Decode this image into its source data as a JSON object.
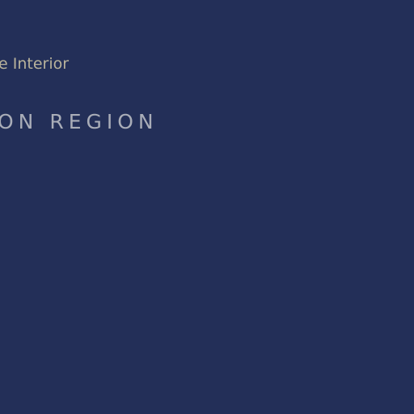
{
  "header": {
    "subtitle": "e Interior",
    "region_title": "ON REGION"
  },
  "colors": {
    "background": "#232f58",
    "subtitle_text": "#b8b29b",
    "title_text": "#a9adb8"
  }
}
